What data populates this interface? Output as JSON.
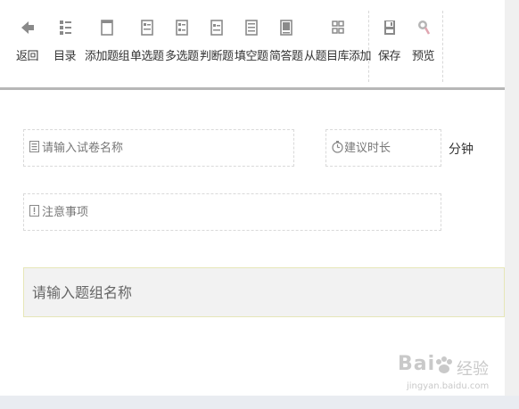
{
  "toolbar": {
    "items": [
      {
        "label": "返回",
        "icon": "back-arrow-icon"
      },
      {
        "label": "目录",
        "icon": "catalog-icon"
      },
      {
        "label": "添加题组",
        "icon": "add-group-icon"
      },
      {
        "label": "单选题",
        "icon": "single-choice-icon"
      },
      {
        "label": "多选题",
        "icon": "multi-choice-icon"
      },
      {
        "label": "判断题",
        "icon": "judgment-icon"
      },
      {
        "label": "填空题",
        "icon": "fill-blank-icon"
      },
      {
        "label": "简答题",
        "icon": "short-answer-icon"
      },
      {
        "label": "从题目库添加",
        "icon": "question-bank-icon"
      },
      {
        "label": "保存",
        "icon": "save-icon"
      },
      {
        "label": "预览",
        "icon": "preview-icon"
      }
    ]
  },
  "form": {
    "paper_name_placeholder": "请输入试卷名称",
    "duration_placeholder": "建议时长",
    "duration_unit": "分钟",
    "notes_placeholder": "注意事项",
    "group_name_placeholder": "请输入题组名称"
  },
  "watermark": {
    "brand": "Bai",
    "brand_cn": "经验",
    "url": "jingyan.baidu.com"
  },
  "colors": {
    "icon": "#8a8a8a",
    "toolbar_border": "#b7b7b7",
    "group_bg": "#f2f2f2",
    "group_border": "#e6e6b8"
  }
}
